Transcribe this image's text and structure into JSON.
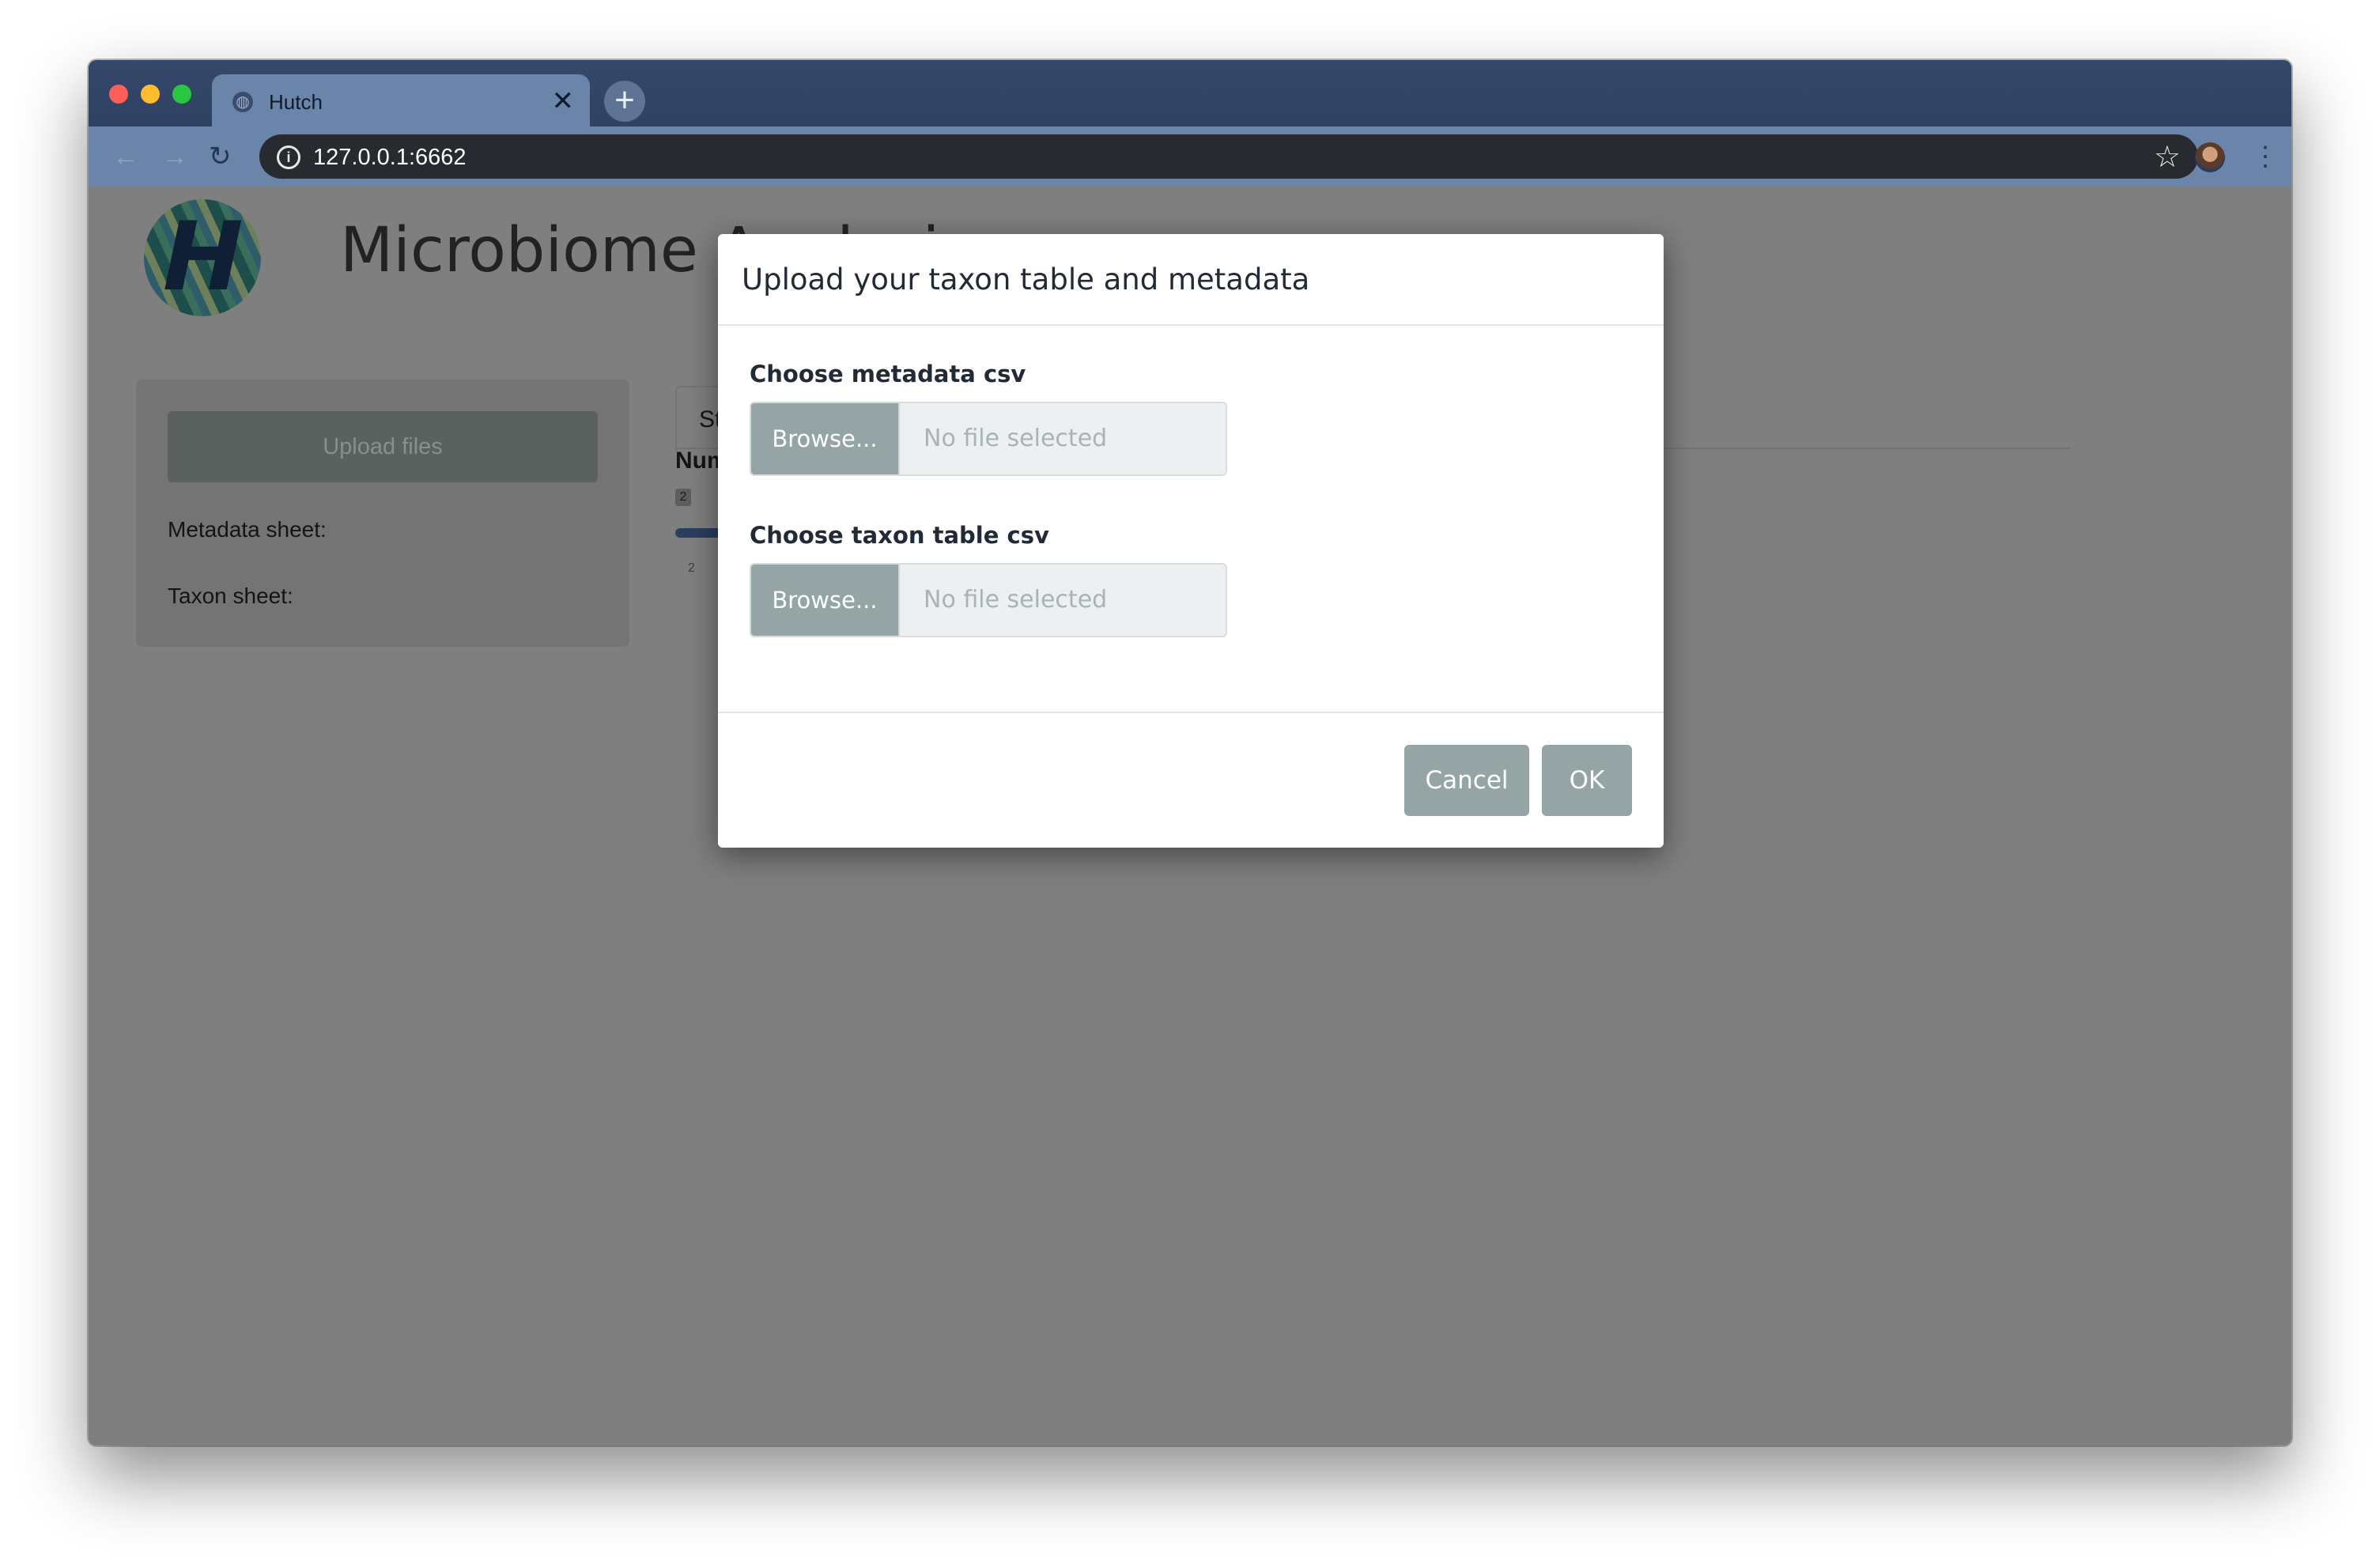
{
  "browser": {
    "tab_title": "Hutch",
    "tab_close_glyph": "✕",
    "new_tab_glyph": "+",
    "url": "127.0.0.1:6662",
    "back_glyph": "←",
    "forward_glyph": "→",
    "reload_glyph": "↻",
    "star_glyph": "☆",
    "menu_glyph": "⋮",
    "info_glyph": "i",
    "globe_glyph": "◍"
  },
  "app": {
    "title": "Microbiome Analysis",
    "logo_letter": "H"
  },
  "sidebar": {
    "upload_label": "Upload files",
    "metadata_label": "Metadata sheet:",
    "taxon_label": "Taxon sheet:"
  },
  "main": {
    "tab_fragment": "St",
    "num_label": "Num",
    "slider_value": "2",
    "slider_tick": "2"
  },
  "modal": {
    "title": "Upload your taxon table and metadata",
    "metadata_field": {
      "label": "Choose metadata csv",
      "browse": "Browse...",
      "placeholder": "No file selected"
    },
    "taxon_field": {
      "label": "Choose taxon table csv",
      "browse": "Browse...",
      "placeholder": "No file selected"
    },
    "cancel_label": "Cancel",
    "ok_label": "OK"
  },
  "colors": {
    "button_gray": "#95a5a6",
    "titlebar": "#36486a",
    "tab_active": "#6b85aa",
    "overlay_page": "#7f7f7f"
  }
}
